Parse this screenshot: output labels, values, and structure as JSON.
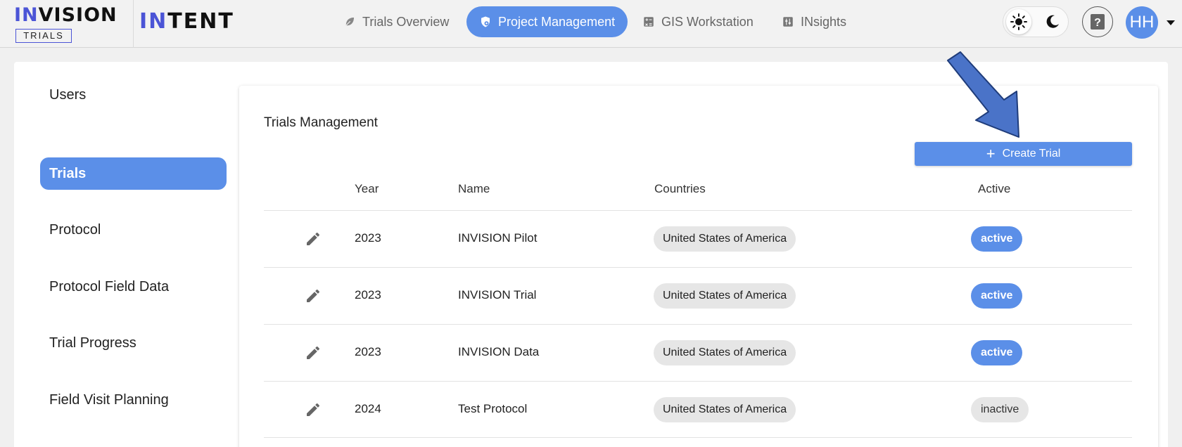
{
  "brand": {
    "name_accent": "IN",
    "name_rest": "VISION",
    "sub": "TRIALS",
    "product_accent": "IN",
    "product_rest": "TENT"
  },
  "nav": [
    {
      "label": "Trials Overview",
      "icon": "leaf-icon"
    },
    {
      "label": "Project Management",
      "icon": "shield-gear-icon",
      "active": true
    },
    {
      "label": "GIS Workstation",
      "icon": "calculator-icon"
    },
    {
      "label": "INsights",
      "icon": "sliders-icon"
    }
  ],
  "header": {
    "help_icon": "question-icon",
    "avatar_initials": "HH"
  },
  "sidebar": {
    "items": [
      {
        "label": "Users"
      },
      {
        "label": "Trials",
        "active": true
      },
      {
        "label": "Protocol"
      },
      {
        "label": "Protocol Field Data"
      },
      {
        "label": "Trial Progress"
      },
      {
        "label": "Field Visit Planning"
      }
    ]
  },
  "trials": {
    "title": "Trials Management",
    "create_label": "Create Trial",
    "columns": {
      "year": "Year",
      "name": "Name",
      "countries": "Countries",
      "active": "Active"
    },
    "rows": [
      {
        "year": "2023",
        "name": "INVISION Pilot",
        "country": "United States of America",
        "status": "active"
      },
      {
        "year": "2023",
        "name": "INVISION Trial",
        "country": "United States of America",
        "status": "active"
      },
      {
        "year": "2023",
        "name": "INVISION Data",
        "country": "United States of America",
        "status": "active"
      },
      {
        "year": "2024",
        "name": "Test Protocol",
        "country": "United States of America",
        "status": "inactive"
      }
    ]
  },
  "colors": {
    "accent": "#5b8fe8",
    "brand": "#4b54d6",
    "annotation_arrow": "#4a73c8"
  }
}
